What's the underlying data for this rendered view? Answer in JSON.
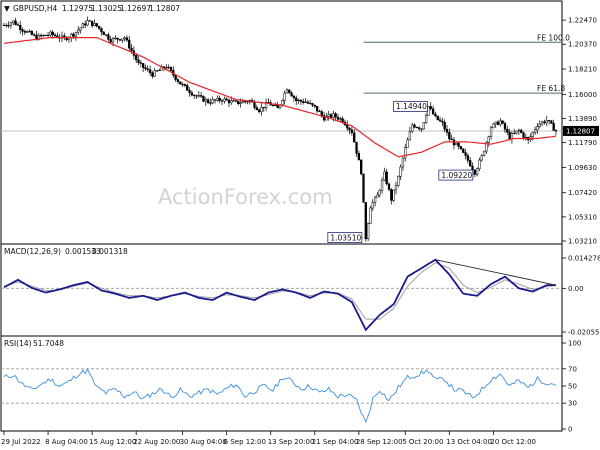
{
  "chart_data": [
    {
      "type": "candlestick",
      "title": "GBPUSD,H4",
      "ohlc_readout": [
        "1.12975",
        "1.13025",
        "1.12697",
        "1.12807"
      ],
      "ylim": [
        1.0321,
        1.2318
      ],
      "y_ticks": [
        {
          "value": 1.2247,
          "label": "1.22470"
        },
        {
          "value": 1.2037,
          "label": "1.20370"
        },
        {
          "value": 1.1821,
          "label": "1.18210"
        },
        {
          "value": 1.16,
          "label": "1.16000"
        },
        {
          "value": 1.1389,
          "label": "1.13890"
        },
        {
          "value": 1.1179,
          "label": "1.11790"
        },
        {
          "value": 1.0963,
          "label": "1.09630"
        },
        {
          "value": 1.0742,
          "label": "1.07420"
        },
        {
          "value": 1.0531,
          "label": "1.05310"
        },
        {
          "value": 1.0321,
          "label": "1.03210"
        }
      ],
      "current_price": {
        "value": 1.12807,
        "label": "1.12807"
      },
      "fib_lines": [
        {
          "label": "FE 100.0",
          "value": 1.2054
        },
        {
          "label": "FE 61.8",
          "value": 1.1611
        }
      ],
      "price_annotations": [
        {
          "label": "1.03510",
          "value": 1.0351,
          "bar": 156
        },
        {
          "label": "1.14940",
          "value": 1.1494,
          "bar": 183
        },
        {
          "label": "1.09220",
          "value": 1.0922,
          "bar": 203
        }
      ],
      "price_waypoints": [
        [
          0,
          1.2203
        ],
        [
          4,
          1.2235
        ],
        [
          8,
          1.2165
        ],
        [
          14,
          1.2095
        ],
        [
          20,
          1.2125
        ],
        [
          26,
          1.2085
        ],
        [
          30,
          1.2126
        ],
        [
          36,
          1.2236
        ],
        [
          40,
          1.2195
        ],
        [
          46,
          1.2075
        ],
        [
          52,
          1.2095
        ],
        [
          58,
          1.1865
        ],
        [
          64,
          1.1775
        ],
        [
          70,
          1.1845
        ],
        [
          76,
          1.1695
        ],
        [
          82,
          1.1595
        ],
        [
          88,
          1.1535
        ],
        [
          94,
          1.1555
        ],
        [
          100,
          1.1525
        ],
        [
          106,
          1.1545
        ],
        [
          110,
          1.1465
        ],
        [
          114,
          1.1525
        ],
        [
          118,
          1.1475
        ],
        [
          122,
          1.1655
        ],
        [
          126,
          1.1545
        ],
        [
          130,
          1.1535
        ],
        [
          134,
          1.1485
        ],
        [
          138,
          1.1395
        ],
        [
          142,
          1.1415
        ],
        [
          146,
          1.1375
        ],
        [
          150,
          1.1275
        ],
        [
          154,
          1.0925
        ],
        [
          156,
          1.0351
        ],
        [
          158,
          1.0625
        ],
        [
          161,
          1.0715
        ],
        [
          164,
          1.0905
        ],
        [
          167,
          1.0685
        ],
        [
          170,
          1.0875
        ],
        [
          173,
          1.1125
        ],
        [
          176,
          1.1335
        ],
        [
          180,
          1.1305
        ],
        [
          183,
          1.1494
        ],
        [
          186,
          1.1395
        ],
        [
          189,
          1.1345
        ],
        [
          192,
          1.1215
        ],
        [
          196,
          1.1135
        ],
        [
          200,
          1.1025
        ],
        [
          203,
          1.0922
        ],
        [
          206,
          1.1055
        ],
        [
          210,
          1.1315
        ],
        [
          214,
          1.1365
        ],
        [
          218,
          1.1225
        ],
        [
          222,
          1.1285
        ],
        [
          226,
          1.1195
        ],
        [
          230,
          1.1335
        ],
        [
          234,
          1.1375
        ],
        [
          238,
          1.1281
        ]
      ],
      "moving_average_waypoints": [
        [
          0,
          1.2045
        ],
        [
          20,
          1.2095
        ],
        [
          40,
          1.2095
        ],
        [
          60,
          1.1925
        ],
        [
          80,
          1.1705
        ],
        [
          100,
          1.1555
        ],
        [
          120,
          1.1505
        ],
        [
          140,
          1.1395
        ],
        [
          150,
          1.1325
        ],
        [
          160,
          1.1175
        ],
        [
          170,
          1.1055
        ],
        [
          180,
          1.1095
        ],
        [
          190,
          1.1185
        ],
        [
          200,
          1.1185
        ],
        [
          210,
          1.1165
        ],
        [
          220,
          1.1215
        ],
        [
          230,
          1.1215
        ],
        [
          238,
          1.1235
        ]
      ],
      "colors": {
        "candle": "#000000",
        "moving_average": "#e8242a",
        "fib_line": "#4f6f66"
      }
    },
    {
      "type": "line",
      "title": "MACD(12,26,9)",
      "readout": [
        "0.001533",
        "0.001318"
      ],
      "ylim": [
        -0.020556,
        0.014278
      ],
      "y_ticks": [
        {
          "value": 0.014278,
          "label": "0.014278"
        },
        {
          "value": 0.0,
          "label": "0.00"
        },
        {
          "value": -0.020556,
          "label": "-0.020556"
        }
      ],
      "macd_waypoints": [
        [
          0,
          0.0005
        ],
        [
          6,
          0.004
        ],
        [
          12,
          0.0002
        ],
        [
          18,
          -0.002
        ],
        [
          24,
          -0.0005
        ],
        [
          30,
          0.0015
        ],
        [
          36,
          0.003
        ],
        [
          42,
          -0.001
        ],
        [
          48,
          -0.0025
        ],
        [
          54,
          -0.0045
        ],
        [
          60,
          -0.0035
        ],
        [
          66,
          -0.0055
        ],
        [
          72,
          -0.0035
        ],
        [
          78,
          -0.002
        ],
        [
          84,
          -0.0045
        ],
        [
          90,
          -0.0055
        ],
        [
          96,
          -0.002
        ],
        [
          102,
          -0.004
        ],
        [
          108,
          -0.0055
        ],
        [
          114,
          -0.002
        ],
        [
          120,
          -0.0005
        ],
        [
          126,
          -0.002
        ],
        [
          132,
          -0.0045
        ],
        [
          138,
          -0.0015
        ],
        [
          144,
          -0.0025
        ],
        [
          150,
          -0.0065
        ],
        [
          156,
          -0.0195
        ],
        [
          162,
          -0.0125
        ],
        [
          168,
          -0.0075
        ],
        [
          174,
          0.0055
        ],
        [
          180,
          0.0095
        ],
        [
          186,
          0.0135
        ],
        [
          192,
          0.0065
        ],
        [
          198,
          -0.0025
        ],
        [
          204,
          -0.0035
        ],
        [
          210,
          0.002
        ],
        [
          216,
          0.0055
        ],
        [
          222,
          0.0
        ],
        [
          228,
          -0.0015
        ],
        [
          234,
          0.0015
        ],
        [
          238,
          0.0015
        ]
      ],
      "signal_waypoints": [
        [
          0,
          0.001
        ],
        [
          6,
          0.003
        ],
        [
          12,
          0.001
        ],
        [
          18,
          -0.001
        ],
        [
          24,
          -0.0008
        ],
        [
          30,
          0.001
        ],
        [
          36,
          0.0025
        ],
        [
          42,
          0.0
        ],
        [
          48,
          -0.002
        ],
        [
          54,
          -0.0035
        ],
        [
          60,
          -0.0035
        ],
        [
          66,
          -0.0045
        ],
        [
          72,
          -0.0035
        ],
        [
          78,
          -0.0025
        ],
        [
          84,
          -0.0038
        ],
        [
          90,
          -0.0045
        ],
        [
          96,
          -0.003
        ],
        [
          102,
          -0.0035
        ],
        [
          108,
          -0.0045
        ],
        [
          114,
          -0.003
        ],
        [
          120,
          -0.0012
        ],
        [
          126,
          -0.0018
        ],
        [
          132,
          -0.0035
        ],
        [
          138,
          -0.0022
        ],
        [
          144,
          -0.0022
        ],
        [
          150,
          -0.005
        ],
        [
          156,
          -0.0145
        ],
        [
          162,
          -0.0145
        ],
        [
          168,
          -0.0095
        ],
        [
          174,
          0.001
        ],
        [
          180,
          0.0075
        ],
        [
          186,
          0.012
        ],
        [
          192,
          0.0095
        ],
        [
          198,
          0.0015
        ],
        [
          204,
          -0.002
        ],
        [
          210,
          0.0005
        ],
        [
          216,
          0.004
        ],
        [
          222,
          0.002
        ],
        [
          228,
          -0.0005
        ],
        [
          234,
          0.0008
        ],
        [
          238,
          0.0013
        ]
      ],
      "trendline": {
        "from": [
          186,
          0.0135
        ],
        "to": [
          238,
          0.0015
        ]
      },
      "colors": {
        "macd": "#1a1a8f",
        "signal": "#a0a0a0",
        "trendline": "#2a2a2a"
      }
    },
    {
      "type": "line",
      "title": "RSI(14)",
      "readout": "51.7048",
      "ylim": [
        0,
        100
      ],
      "y_ticks": [
        {
          "value": 100,
          "label": "100"
        },
        {
          "value": 70,
          "label": "70"
        },
        {
          "value": 50,
          "label": "50"
        },
        {
          "value": 30,
          "label": "30"
        },
        {
          "value": 0,
          "label": "0"
        }
      ],
      "levels": [
        70,
        30
      ],
      "rsi_waypoints": [
        [
          0,
          60
        ],
        [
          4,
          63
        ],
        [
          8,
          52
        ],
        [
          12,
          45
        ],
        [
          16,
          52
        ],
        [
          20,
          58
        ],
        [
          24,
          50
        ],
        [
          28,
          55
        ],
        [
          32,
          64
        ],
        [
          36,
          68
        ],
        [
          40,
          48
        ],
        [
          44,
          42
        ],
        [
          48,
          46
        ],
        [
          52,
          38
        ],
        [
          56,
          43
        ],
        [
          60,
          35
        ],
        [
          64,
          41
        ],
        [
          68,
          47
        ],
        [
          72,
          37
        ],
        [
          76,
          45
        ],
        [
          80,
          38
        ],
        [
          84,
          42
        ],
        [
          88,
          46
        ],
        [
          92,
          40
        ],
        [
          96,
          47
        ],
        [
          100,
          52
        ],
        [
          104,
          38
        ],
        [
          108,
          44
        ],
        [
          112,
          50
        ],
        [
          116,
          45
        ],
        [
          120,
          60
        ],
        [
          124,
          56
        ],
        [
          128,
          47
        ],
        [
          132,
          50
        ],
        [
          136,
          42
        ],
        [
          140,
          46
        ],
        [
          144,
          38
        ],
        [
          148,
          40
        ],
        [
          152,
          33
        ],
        [
          156,
          7
        ],
        [
          159,
          35
        ],
        [
          162,
          46
        ],
        [
          166,
          33
        ],
        [
          170,
          48
        ],
        [
          174,
          60
        ],
        [
          178,
          63
        ],
        [
          183,
          68
        ],
        [
          186,
          57
        ],
        [
          190,
          58
        ],
        [
          194,
          46
        ],
        [
          198,
          44
        ],
        [
          202,
          36
        ],
        [
          206,
          46
        ],
        [
          210,
          58
        ],
        [
          214,
          64
        ],
        [
          218,
          50
        ],
        [
          222,
          56
        ],
        [
          226,
          48
        ],
        [
          230,
          58
        ],
        [
          234,
          54
        ],
        [
          238,
          52
        ]
      ],
      "colors": {
        "rsi": "#3d8fe0",
        "level": "#9a9a9a"
      }
    }
  ],
  "x_axis_labels": [
    {
      "bar": 0,
      "label": "29 Jul 2022"
    },
    {
      "bar": 19,
      "label": "8 Aug 04:00"
    },
    {
      "bar": 38,
      "label": "15 Aug 12:00"
    },
    {
      "bar": 57,
      "label": "22 Aug 20:00"
    },
    {
      "bar": 77,
      "label": "30 Aug 04:00"
    },
    {
      "bar": 96,
      "label": "6 Sep 12:00"
    },
    {
      "bar": 115,
      "label": "13 Sep 20:00"
    },
    {
      "bar": 134,
      "label": "21 Sep 04:00"
    },
    {
      "bar": 153,
      "label": "28 Sep 12:00"
    },
    {
      "bar": 173,
      "label": "5 Oct 20:00"
    },
    {
      "bar": 192,
      "label": "13 Oct 04:00"
    },
    {
      "bar": 211,
      "label": "20 Oct 12:00"
    }
  ],
  "watermark": "ActionForex.com",
  "arrow_icon": "down-triangle-icon",
  "colors": {
    "grid_border": "#000000",
    "text": "#111111",
    "badge_bg": "#ffffff"
  }
}
